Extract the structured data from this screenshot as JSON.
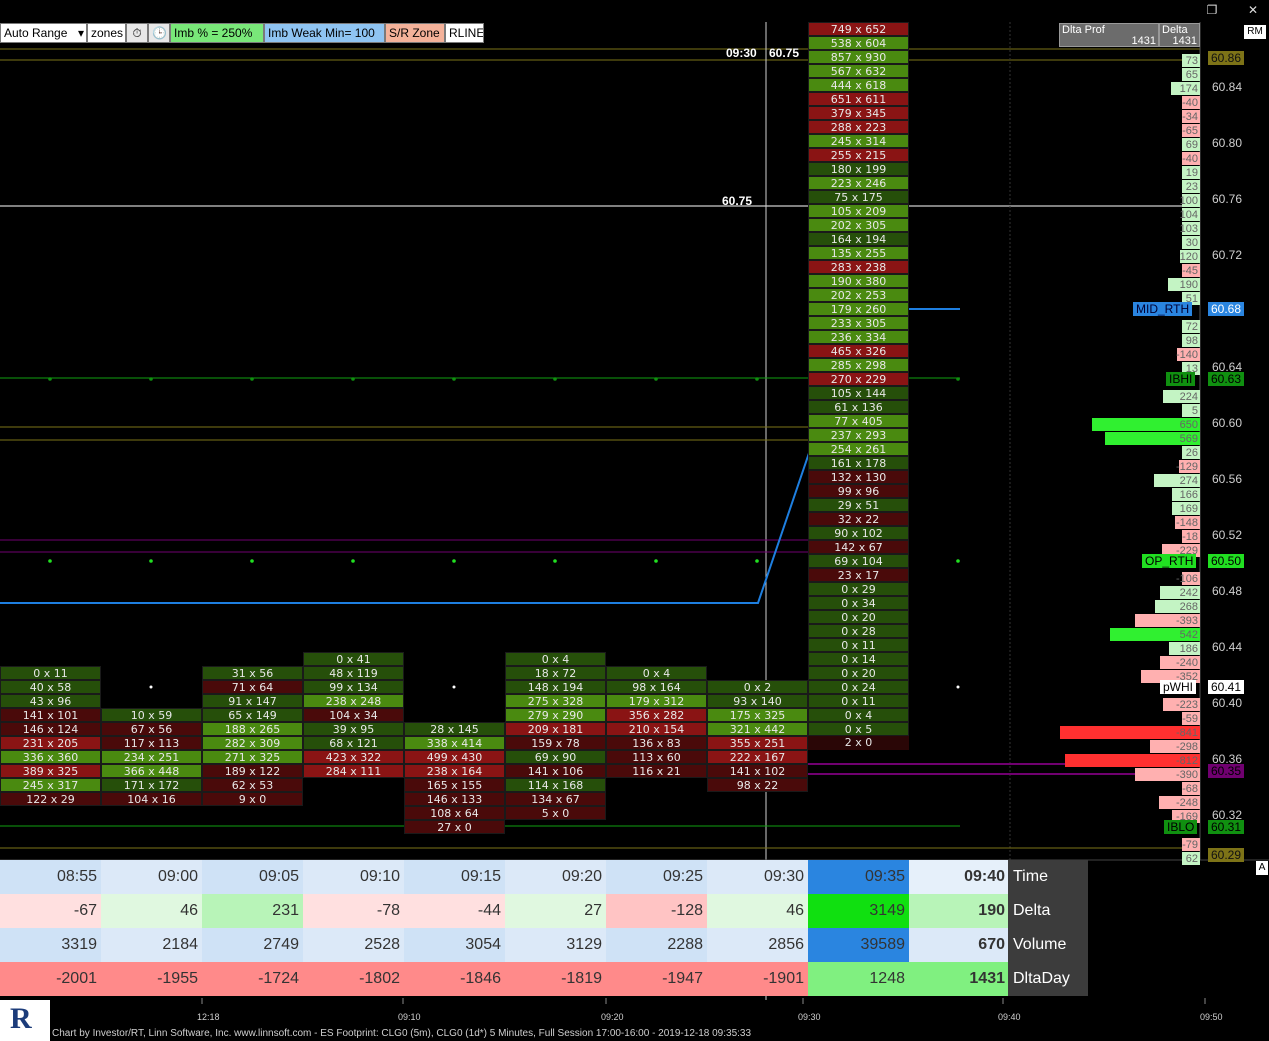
{
  "window": {
    "restore_glyph": "❐",
    "close_glyph": "✕"
  },
  "toolbar": {
    "auto_range": "Auto Range",
    "dropdown_glyph": "▾",
    "zones": "zones",
    "stopwatch_glyph": "⏱",
    "clock_glyph": "🕒",
    "imb": "Imb % = 250%",
    "imb_weak": "Imb Weak Min= 100",
    "sr_zone": "S/R Zone",
    "rline": "RLINE"
  },
  "colors": {
    "bid_strong": "#4a8a10",
    "bid_weak": "#264f0a",
    "ask_strong": "#8a1414",
    "ask_weak": "#4a0a0a",
    "vwap": "#1e7fe0",
    "ib": "#10a010",
    "op_rth": "#21e021",
    "mid_rth": "#2a85e0",
    "pwhi": "#ffffff",
    "pwlo": "#700070",
    "gold": "#7d7317"
  },
  "header": {
    "dlta_prof": "Dlta Prof",
    "delta": "Delta",
    "dlta_prof_value": "1431",
    "delta_value": "1431",
    "rm": "RM"
  },
  "price_axis": [
    "60.84",
    "60.80",
    "60.76",
    "60.72",
    "60.68",
    "60.64",
    "60.60",
    "60.56",
    "60.52",
    "60.48",
    "60.44",
    "60.40",
    "60.36",
    "60.32"
  ],
  "tags": {
    "t1": "60.86",
    "t2": "60.29",
    "mid_rth_name": "MID_RTH",
    "mid_rth_price": "60.68",
    "ibhi_name": "IBHI",
    "ibhi_price": "60.63",
    "op_rth_name": "OP_RTH",
    "op_rth_price": "60.50",
    "pwhi_name": "pWHI",
    "pwhi_price": "60.41",
    "pwlo_price": "60.35",
    "iblo_name": "IBLO",
    "iblo_price": "60.31"
  },
  "labels": {
    "time_label": "09:30",
    "price_label": "60.75",
    "crosshair_price": "60.75"
  },
  "delta_profile": [
    73,
    65,
    174,
    -40,
    -34,
    -65,
    69,
    -40,
    19,
    23,
    100,
    104,
    103,
    30,
    120,
    -45,
    190,
    51,
    null,
    72,
    98,
    -140,
    13,
    null,
    224,
    5,
    650,
    569,
    26,
    -129,
    274,
    166,
    169,
    -148,
    -18,
    -229,
    null,
    -106,
    242,
    268,
    -393,
    542,
    186,
    -240,
    -352,
    null,
    -223,
    -59,
    -841,
    -298,
    -812,
    -390,
    -68,
    -248,
    -169,
    null,
    -79,
    62
  ],
  "columns": [
    {
      "top": [
        0,
        11
      ],
      "cells": [
        "0 x 11",
        "40 x 58",
        "43 x 96",
        "141 x 101",
        "146 x 124",
        "231 x 205",
        "336 x 360",
        "389 x 325",
        "245 x 317",
        "122 x 29"
      ]
    },
    {
      "top": [
        10,
        59
      ],
      "cells": [
        "10 x 59",
        "67 x 56",
        "117 x 113",
        "234 x 251",
        "366 x 448",
        "171 x 172",
        "104 x 16"
      ]
    },
    {
      "top": [
        31,
        56
      ],
      "cells": [
        "31 x 56",
        "71 x 64",
        "91 x 147",
        "65 x 149",
        "188 x 265",
        "282 x 309",
        "271 x 325",
        "189 x 122",
        "62 x 53",
        "9 x 0"
      ]
    },
    {
      "top": [
        0,
        41
      ],
      "cells": [
        "0 x 41",
        "48 x 119",
        "99 x 134",
        "238 x 248",
        "104 x 34",
        "39 x 95",
        "68 x 121",
        "423 x 322",
        "284 x 111"
      ]
    },
    {
      "top": [
        28,
        145
      ],
      "cells": [
        "28 x 145",
        "338 x 414",
        "499 x 430",
        "238 x 164",
        "165 x 155",
        "146 x 133",
        "108 x 64",
        "27 x 0"
      ]
    },
    {
      "top": [
        0,
        4
      ],
      "cells": [
        "0 x 4",
        "18 x 72",
        "148 x 194",
        "275 x 328",
        "279 x 290",
        "209 x 181",
        "159 x 78",
        "69 x 90",
        "141 x 106",
        "114 x 168",
        "134 x 67",
        "5 x 0"
      ]
    },
    {
      "top": [
        0,
        4
      ],
      "cells": [
        "0 x 4",
        "98 x 164",
        "179 x 312",
        "356 x 282",
        "210 x 154",
        "136 x 83",
        "113 x 60",
        "116 x 21"
      ]
    },
    {
      "top": [
        0,
        2
      ],
      "cells": [
        "0 x 2",
        "93 x 140",
        "175 x 325",
        "321 x 442",
        "355 x 251",
        "222 x 167",
        "141 x 102",
        "98 x 22"
      ]
    },
    {
      "top": [
        749,
        652
      ],
      "cells": [
        "749 x 652",
        "538 x 604",
        "857 x 930",
        "567 x 632",
        "444 x 618",
        "651 x 611",
        "379 x 345",
        "288 x 223",
        "245 x 314",
        "255 x 215",
        "180 x 199",
        "223 x 246",
        "75 x 175",
        "105 x 209",
        "202 x 305",
        "164 x 194",
        "135 x 255",
        "283 x 238",
        "190 x 380",
        "202 x 253",
        "179 x 260",
        "233 x 305",
        "236 x 334",
        "465 x 326",
        "285 x 298",
        "270 x 229",
        "105 x 144",
        "61 x 136",
        "77 x 405",
        "237 x 293",
        "254 x 261",
        "161 x 178",
        "132 x 130",
        "99 x 96",
        "29 x 51",
        "32 x 22",
        "90 x 102",
        "142 x 67",
        "69 x 104",
        "23 x 17",
        "0 x 29",
        "0 x 34",
        "0 x 20",
        "0 x 28",
        "0 x 11",
        "0 x 14",
        "0 x 20",
        "0 x 24",
        "0 x 11",
        "0 x 4",
        "0 x 5"
      ],
      "extra": "2 x 0"
    }
  ],
  "table": {
    "times": [
      "08:55",
      "09:00",
      "09:05",
      "09:10",
      "09:15",
      "09:20",
      "09:25",
      "09:30",
      "09:35",
      "09:40"
    ],
    "deltas": [
      "-67",
      "46",
      "231",
      "-78",
      "-44",
      "27",
      "-128",
      "46",
      "3149",
      "190"
    ],
    "volumes": [
      "3319",
      "2184",
      "2749",
      "2528",
      "3054",
      "3129",
      "2288",
      "2856",
      "39589",
      "670"
    ],
    "dltaday": [
      "-2001",
      "-1955",
      "-1724",
      "-1802",
      "-1846",
      "-1819",
      "-1947",
      "-1901",
      "1248",
      "1431"
    ],
    "row_labels": [
      "Time",
      "Delta",
      "Volume",
      "DltaDay"
    ],
    "scroll_glyph": "A"
  },
  "xaxis": [
    "12:18",
    "09:10",
    "09:20",
    "09:30",
    "09:40",
    "09:50"
  ],
  "footer": {
    "logo_letter": "R",
    "text": "Chart by Investor/RT, Linn Software, Inc. www.linnsoft.com - ES Footprint: CLG0 (5m), CLG0 (1d*) 5 Minutes, Full Session 17:00-16:00 - 2019-12-18 09:35:33"
  }
}
